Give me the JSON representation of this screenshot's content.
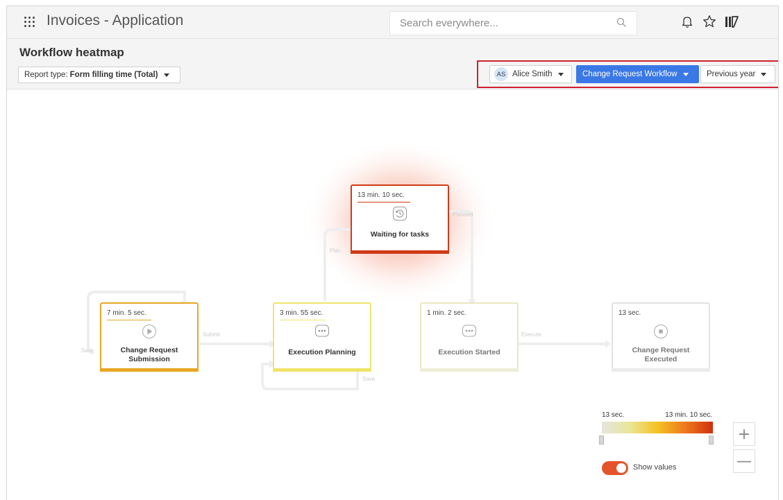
{
  "app": {
    "title": "Invoices - Application"
  },
  "search": {
    "placeholder": "Search everywhere..."
  },
  "header": {
    "title": "Workflow heatmap",
    "report_type_label": "Report type:",
    "report_type_value": "Form filling time (Total)",
    "user": {
      "initials": "AS",
      "name": "Alice Smith"
    },
    "workflow": "Change Request Workflow",
    "period": "Previous year"
  },
  "nodes": [
    {
      "time": "7 min. 5 sec.",
      "label": "Change Request Submission",
      "label_lines": [
        "Change Request",
        "Submission"
      ],
      "icon": "play-icon",
      "color": "#e8a722"
    },
    {
      "time": "3 min. 55 sec.",
      "label": "Execution Planning",
      "icon": "ellipsis-icon",
      "color": "#eee46a"
    },
    {
      "time": "13 min. 10 sec.",
      "label": "Waiting for tasks",
      "icon": "history-icon",
      "color": "#cf3a16"
    },
    {
      "time": "1 min. 2 sec.",
      "label": "Execution Started",
      "icon": "ellipsis-icon",
      "color": "#e9e8c2"
    },
    {
      "time": "13 sec.",
      "label": "Change Request Executed",
      "label_lines": [
        "Change Request",
        "Executed"
      ],
      "icon": "stop-icon",
      "color": "#e3e3e3"
    }
  ],
  "edge_labels": {
    "submit": "Submit",
    "plan": "Plan",
    "planned": "Planned",
    "execute": "Execute",
    "save": "Save",
    "save2": "Save"
  },
  "legend": {
    "min": "13 sec.",
    "max": "13 min. 10 sec.",
    "colors": [
      "#e5e5e0",
      "#e9e69a",
      "#f4c322",
      "#ed7a1c",
      "#cf3010"
    ]
  },
  "toggle": {
    "label": "Show values",
    "on": true
  },
  "zoom": {
    "in": "+",
    "out": "—"
  }
}
